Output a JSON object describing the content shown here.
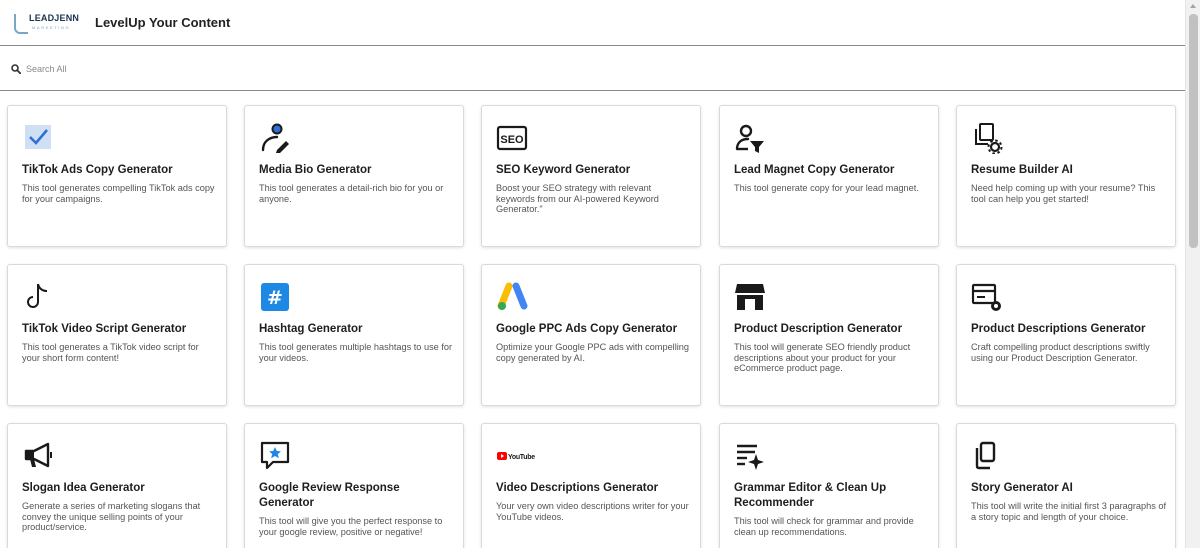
{
  "header": {
    "logo_text": "LEADJENN",
    "logo_subtext": "MARKETING",
    "title": "LevelUp Your Content"
  },
  "search": {
    "placeholder": "Search All",
    "value": ""
  },
  "colors": {
    "accent": "#2f6fd6",
    "check_bg": "#cfe0f5",
    "hashtag_bg": "#1e88e5",
    "youtube_red": "#ff0000",
    "icon_dark": "#1a1a1a"
  },
  "cards": [
    {
      "title": "TikTok Ads Copy Generator",
      "description": "This tool generates compelling TikTok ads copy for your campaigns.",
      "icon": "checkmark-icon"
    },
    {
      "title": "Media Bio Generator",
      "description": "This tool generates a detail-rich bio for you or anyone.",
      "icon": "person-edit-icon"
    },
    {
      "title": "SEO Keyword Generator",
      "description": "Boost your SEO strategy with relevant keywords from our AI-powered Keyword Generator.\"",
      "icon": "seo-icon"
    },
    {
      "title": "Lead Magnet Copy Generator",
      "description": "This tool generate copy for your lead magnet.",
      "icon": "person-filter-icon"
    },
    {
      "title": "Resume Builder AI",
      "description": "Need help coming up with your resume? This tool can help you get started!",
      "icon": "documents-gear-icon"
    },
    {
      "title": "TikTok Video Script Generator",
      "description": "This tool generates a TikTok video script for your short form content!",
      "icon": "tiktok-icon"
    },
    {
      "title": "Hashtag Generator",
      "description": "This tool generates multiple hashtags to use for your videos.",
      "icon": "hashtag-icon"
    },
    {
      "title": "Google PPC Ads Copy Generator",
      "description": "Optimize your Google PPC ads with compelling copy generated by AI.",
      "icon": "google-ads-icon"
    },
    {
      "title": "Product Description Generator",
      "description": "This tool will generate SEO friendly product descriptions about your product for your eCommerce product page.",
      "icon": "storefront-icon"
    },
    {
      "title": "Product Descriptions Generator",
      "description": "Craft compelling product descriptions swiftly using our Product Description Generator.",
      "icon": "card-gear-icon"
    },
    {
      "title": "Slogan Idea Generator",
      "description": "Generate a series of marketing slogans that convey the unique selling points of your product/service.",
      "icon": "megaphone-icon"
    },
    {
      "title": "Google Review Response Generator",
      "description": "This tool will give you the perfect response to your google review, positive or negative!",
      "icon": "review-star-icon"
    },
    {
      "title": "Video Descriptions Generator",
      "description": "Your very own video descriptions writer for your YouTube videos.",
      "icon": "youtube-logo-icon",
      "icon_text": "YouTube"
    },
    {
      "title": "Grammar Editor & Clean Up Recommender",
      "description": "This tool will check for grammar and provide clean up recommendations.",
      "icon": "text-sparkle-icon"
    },
    {
      "title": "Story Generator AI",
      "description": "This tool will write the initial first 3 paragraphs of a story topic and length of your choice.",
      "icon": "copy-document-icon"
    }
  ]
}
